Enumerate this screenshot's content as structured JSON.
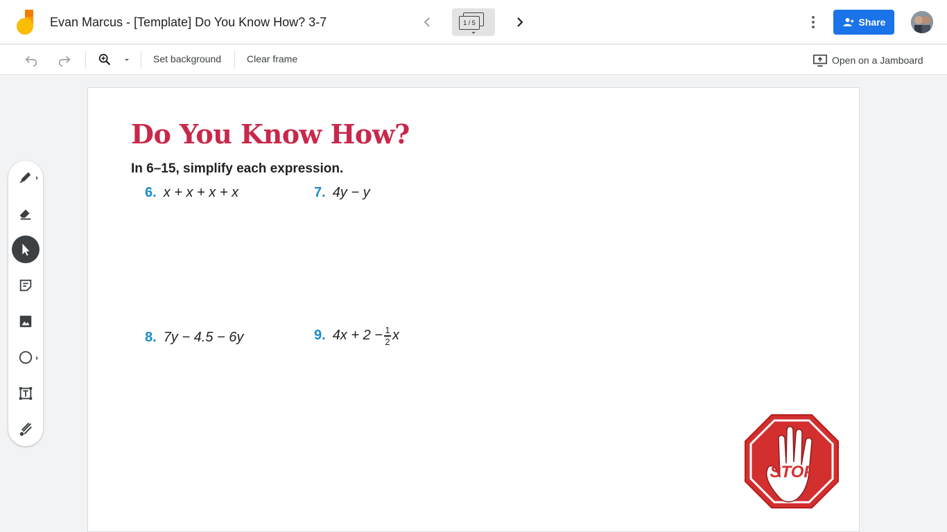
{
  "header": {
    "title": "Evan Marcus - [Template] Do You Know How? 3-7",
    "frame_indicator": "1 / 5",
    "share_label": "Share"
  },
  "toolbar": {
    "set_background_label": "Set background",
    "clear_frame_label": "Clear frame",
    "open_jamboard_label": "Open on a Jamboard"
  },
  "tools": [
    "pen-icon",
    "eraser-icon",
    "select-icon",
    "sticky-note-icon",
    "image-icon",
    "shape-icon",
    "text-box-icon",
    "laser-icon"
  ],
  "canvas": {
    "heading": "Do You Know How?",
    "instruction_prefix": "In ",
    "instruction_range": "6–15",
    "instruction_suffix": ", simplify each expression.",
    "problems": [
      {
        "num": "6.",
        "expr": "x + x + x + x"
      },
      {
        "num": "7.",
        "expr": "4y − y"
      },
      {
        "num": "8.",
        "expr": "7y − 4.5 − 6y"
      },
      {
        "num": "9.",
        "expr_before": "4x + 2 −",
        "frac_num": "1",
        "frac_den": "2",
        "expr_after": "x"
      }
    ],
    "stop_sign_text": "STOP"
  }
}
